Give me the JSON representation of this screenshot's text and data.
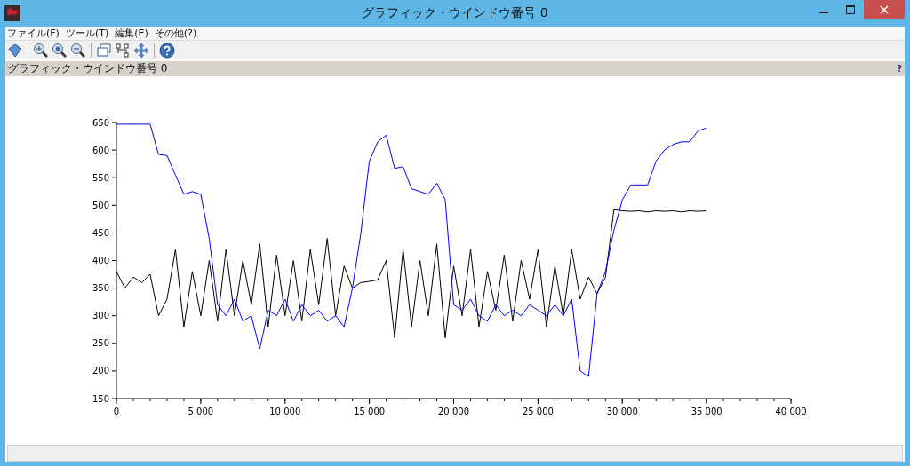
{
  "window": {
    "title": "グラフィック・ウインドウ番号 0"
  },
  "menu": [
    "ファイル(F)",
    "ツール(T)",
    "編集(E)",
    "その他(?)"
  ],
  "panel": {
    "title": "グラフィック・ウインドウ番号 0",
    "help": "?"
  },
  "chart_data": {
    "type": "line",
    "x": [
      0,
      500,
      1000,
      1500,
      2000,
      2500,
      3000,
      3500,
      4000,
      4500,
      5000,
      5500,
      6000,
      6500,
      7000,
      7500,
      8000,
      8500,
      9000,
      9500,
      10000,
      10500,
      11000,
      11500,
      12000,
      12500,
      13000,
      13500,
      14000,
      14500,
      15000,
      15500,
      16000,
      16500,
      17000,
      17500,
      18000,
      18500,
      19000,
      19500,
      20000,
      20500,
      21000,
      21500,
      22000,
      22500,
      23000,
      23500,
      24000,
      24500,
      25000,
      25500,
      26000,
      26500,
      27000,
      27500,
      28000,
      28500,
      29000,
      29500,
      30000,
      30500,
      31000,
      31500,
      32000,
      32500,
      33000,
      33500,
      34000,
      34500,
      35000
    ],
    "series": [
      {
        "color": "#000000",
        "values": [
          380,
          350,
          370,
          360,
          375,
          300,
          330,
          420,
          280,
          380,
          300,
          400,
          290,
          420,
          300,
          400,
          320,
          430,
          280,
          410,
          300,
          400,
          290,
          420,
          320,
          440,
          300,
          390,
          350,
          360,
          362,
          365,
          400,
          260,
          420,
          280,
          400,
          300,
          430,
          260,
          390,
          300,
          420,
          280,
          380,
          310,
          410,
          290,
          400,
          330,
          420,
          280,
          390,
          300,
          420,
          330,
          370,
          340,
          370,
          492,
          490,
          489,
          490,
          488,
          490,
          489,
          490,
          488,
          490,
          489,
          490
        ]
      },
      {
        "color": "#0000ff",
        "values": [
          647,
          647,
          647,
          647,
          647,
          592,
          590,
          555,
          520,
          525,
          520,
          440,
          320,
          300,
          330,
          290,
          300,
          240,
          310,
          300,
          330,
          290,
          320,
          300,
          310,
          290,
          300,
          280,
          350,
          450,
          580,
          615,
          627,
          567,
          570,
          530,
          525,
          520,
          540,
          510,
          320,
          310,
          330,
          300,
          290,
          320,
          300,
          310,
          300,
          320,
          310,
          300,
          320,
          300,
          330,
          200,
          190,
          340,
          380,
          455,
          510,
          537,
          537,
          537,
          580,
          600,
          610,
          615,
          615,
          635,
          640
        ]
      }
    ],
    "xlim": [
      0,
      40000
    ],
    "ylim": [
      150,
      650
    ],
    "xticks": [
      {
        "value": 0,
        "label": "0"
      },
      {
        "value": 5000,
        "label": "5 000"
      },
      {
        "value": 10000,
        "label": "10 000"
      },
      {
        "value": 15000,
        "label": "15 000"
      },
      {
        "value": 20000,
        "label": "20 000"
      },
      {
        "value": 25000,
        "label": "25 000"
      },
      {
        "value": 30000,
        "label": "30 000"
      },
      {
        "value": 35000,
        "label": "35 000"
      },
      {
        "value": 40000,
        "label": "40 000"
      }
    ],
    "yticks": [
      150,
      200,
      250,
      300,
      350,
      400,
      450,
      500,
      550,
      600,
      650
    ]
  }
}
